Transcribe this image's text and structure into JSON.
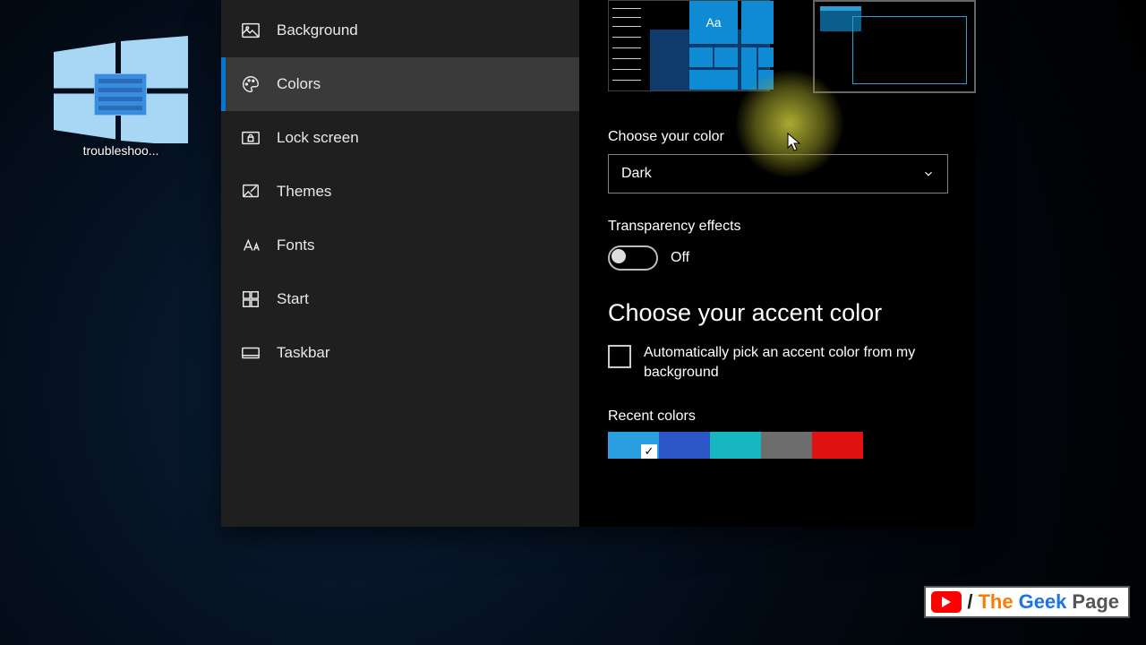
{
  "desktop": {
    "icon_label": "troubleshoo..."
  },
  "sidebar": {
    "items": [
      {
        "label": "Background"
      },
      {
        "label": "Colors"
      },
      {
        "label": "Lock screen"
      },
      {
        "label": "Themes"
      },
      {
        "label": "Fonts"
      },
      {
        "label": "Start"
      },
      {
        "label": "Taskbar"
      }
    ],
    "selected_index": 1
  },
  "content": {
    "preview_tile_text": "Aa",
    "choose_color_label": "Choose your color",
    "color_dropdown_value": "Dark",
    "transparency_label": "Transparency effects",
    "transparency_state": "Off",
    "accent_heading": "Choose your accent color",
    "auto_accent_label": "Automatically pick an accent color from my background",
    "recent_colors_label": "Recent colors",
    "recent_colors": [
      "#2b9fe0",
      "#2d57c7",
      "#17b7c0",
      "#6d6d6d",
      "#e11212"
    ],
    "recent_selected_index": 0
  },
  "watermark": {
    "slash": "/",
    "brand1": "The",
    "brand2": "Geek",
    "brand3": "Page"
  }
}
